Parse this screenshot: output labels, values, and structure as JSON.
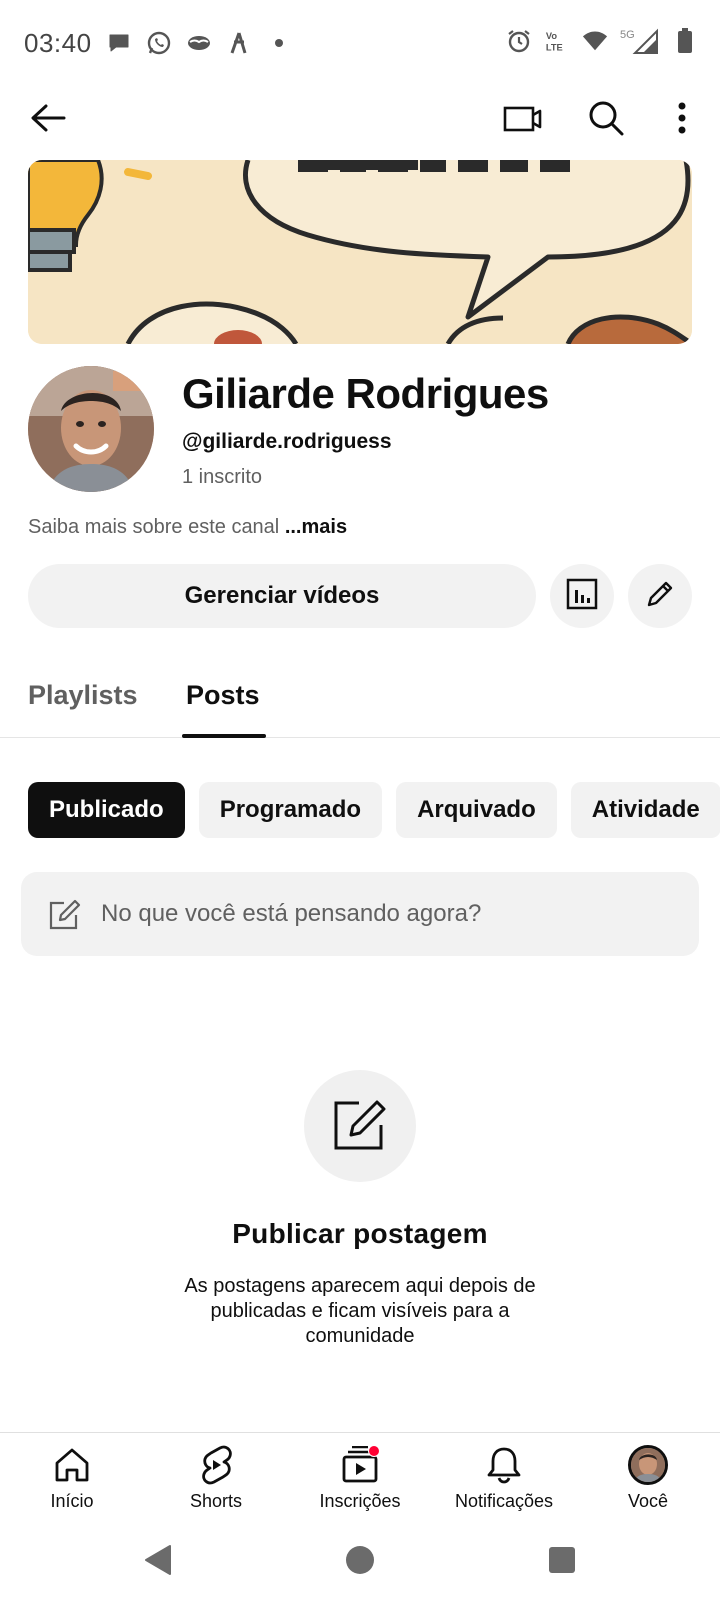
{
  "status_bar": {
    "time": "03:40",
    "left_icons": [
      "chat-bubble-icon",
      "whatsapp-icon",
      "mask-icon",
      "app-icon",
      "dot-icon"
    ],
    "right_icons": [
      "alarm-icon",
      "volte-icon",
      "wifi-icon",
      "signal-icon",
      "battery-icon"
    ],
    "volte_label": "Vo LTE",
    "network_label": "5G"
  },
  "app_bar": {
    "icons": [
      "back-arrow-icon",
      "cast-icon",
      "search-icon",
      "more-vert-icon"
    ]
  },
  "channel": {
    "name": "Giliarde Rodrigues",
    "handle": "@giliarde.rodriguess",
    "subscribers": "1 inscrito",
    "about_text": "Saiba mais sobre este canal ",
    "about_more": "...mais",
    "manage_button": "Gerenciar vídeos"
  },
  "tabs": [
    {
      "label": "Playlists",
      "active": false
    },
    {
      "label": "Posts",
      "active": true
    }
  ],
  "chips": [
    {
      "label": "Publicado",
      "active": true
    },
    {
      "label": "Programado",
      "active": false
    },
    {
      "label": "Arquivado",
      "active": false
    },
    {
      "label": "Atividade",
      "active": false
    }
  ],
  "composer": {
    "placeholder": "No que você está pensando agora?"
  },
  "empty_state": {
    "title": "Publicar postagem",
    "description": "As postagens aparecem aqui depois de publicadas e ficam visíveis para a comunidade"
  },
  "bottom_nav": [
    {
      "label": "Início",
      "icon": "home-icon"
    },
    {
      "label": "Shorts",
      "icon": "shorts-icon"
    },
    {
      "label": "Inscrições",
      "icon": "subscriptions-icon",
      "badge": true
    },
    {
      "label": "Notificações",
      "icon": "bell-icon"
    },
    {
      "label": "Você",
      "icon": "avatar"
    }
  ],
  "colors": {
    "text": "#0f0f0f",
    "secondary_text": "#606060",
    "chip_bg": "#f2f2f2",
    "badge_red": "#ff0033"
  }
}
